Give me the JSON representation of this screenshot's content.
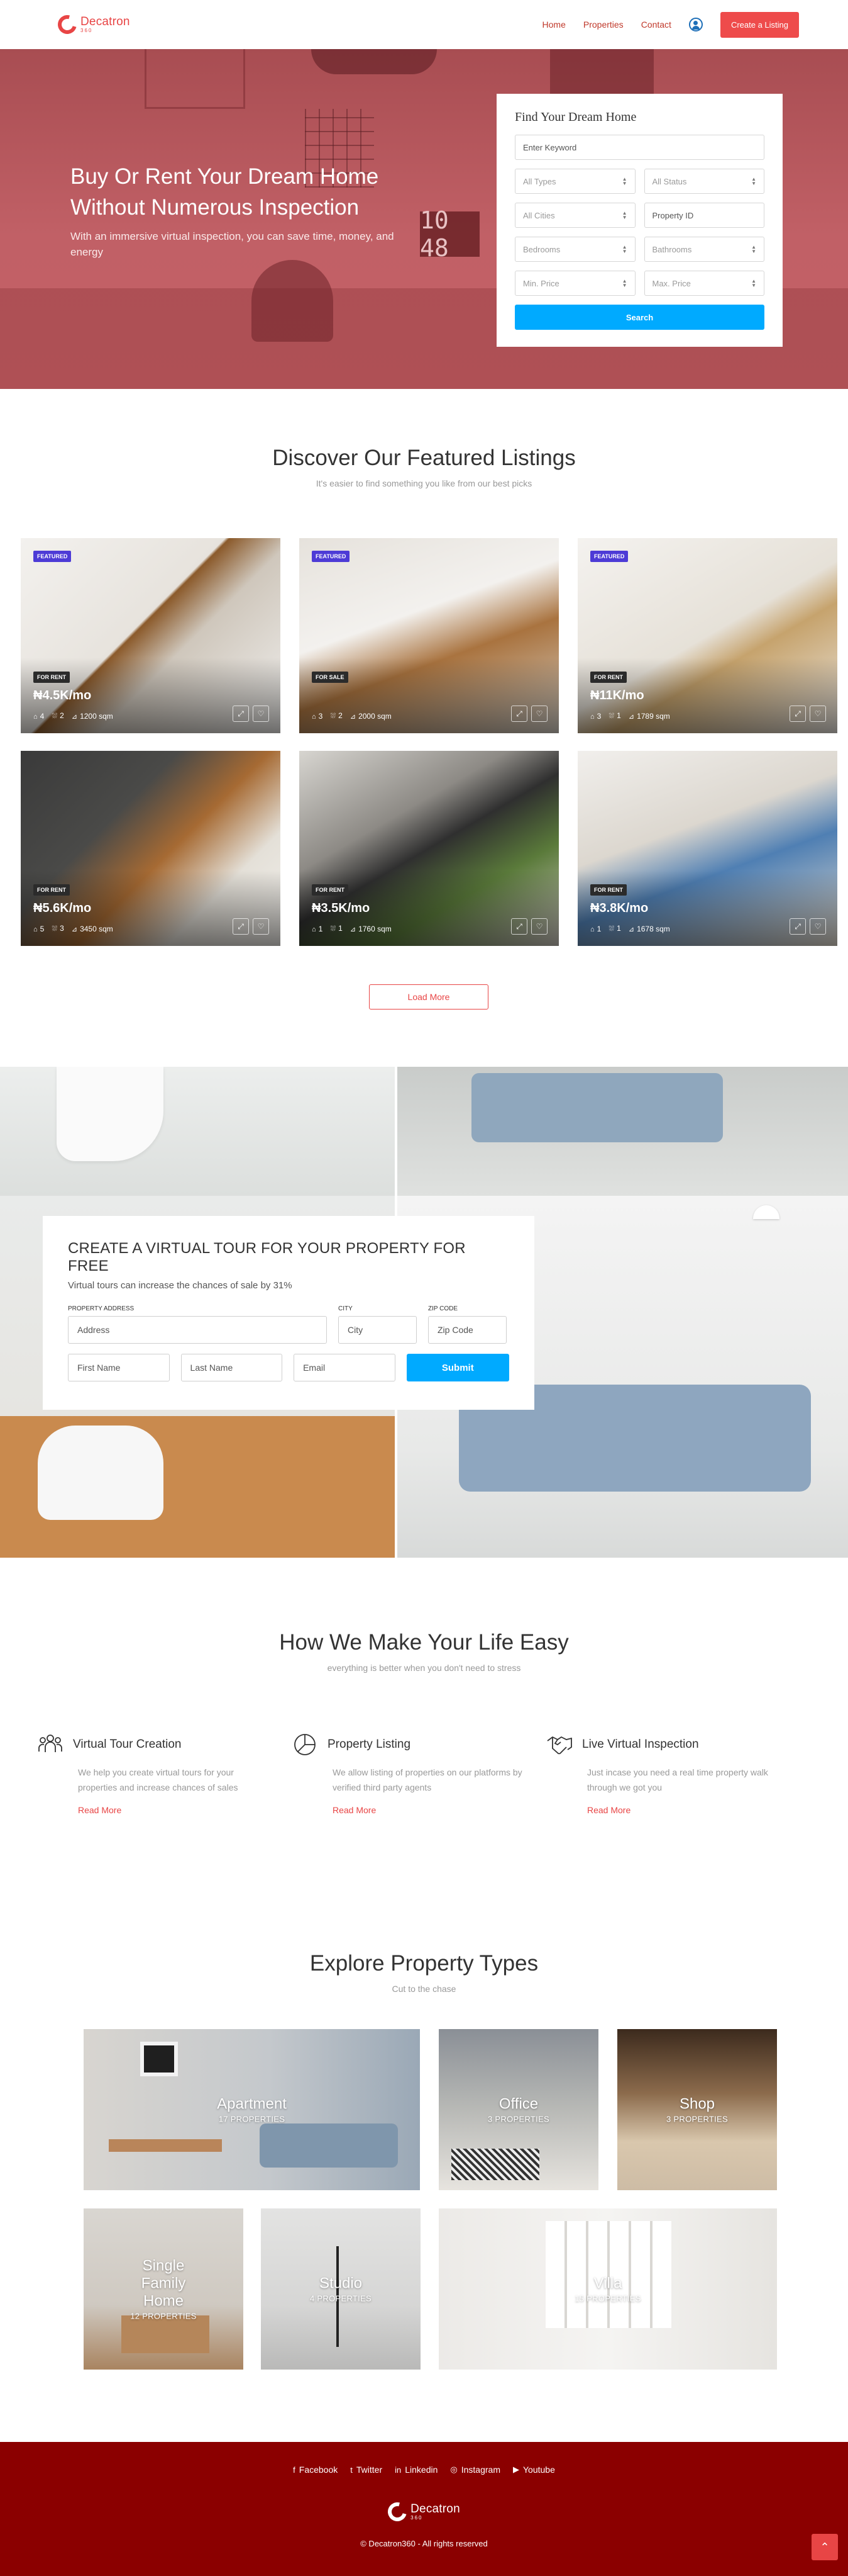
{
  "nav": {
    "logo_name": "Decatron",
    "logo_sub": "360",
    "links": [
      "Home",
      "Properties",
      "Contact"
    ],
    "create_label": "Create a Listing"
  },
  "hero": {
    "title_line1": "Buy Or Rent Your Dream Home",
    "title_line2": "Without Numerous Inspection",
    "description": "With an immersive virtual inspection, you can save time, money, and energy",
    "clock_text": "10 48"
  },
  "search": {
    "title": "Find Your Dream Home",
    "keyword_placeholder": "Enter Keyword",
    "types": "All Types",
    "status": "All Status",
    "cities": "All Cities",
    "property_id": "Property ID",
    "bedrooms": "Bedrooms",
    "bathrooms": "Bathrooms",
    "min_price": "Min. Price",
    "max_price": "Max. Price",
    "button": "Search"
  },
  "featured": {
    "title": "Discover Our Featured Listings",
    "subtitle": "It's easier to find something you like from our best picks",
    "load_more": "Load More",
    "cards": [
      {
        "featured": "FEATURED",
        "status": "FOR RENT",
        "price": "₦4.5K/mo",
        "beds": "4",
        "baths": "2",
        "area": "1200 sqm"
      },
      {
        "featured": "FEATURED",
        "status": "FOR SALE",
        "price": "",
        "beds": "3",
        "baths": "2",
        "area": "2000 sqm"
      },
      {
        "featured": "FEATURED",
        "status": "FOR RENT",
        "price": "₦11K/mo",
        "beds": "3",
        "baths": "1",
        "area": "1789 sqm"
      },
      {
        "featured": "",
        "status": "FOR RENT",
        "price": "₦5.6K/mo",
        "beds": "5",
        "baths": "3",
        "area": "3450 sqm"
      },
      {
        "featured": "",
        "status": "FOR RENT",
        "price": "₦3.5K/mo",
        "beds": "1",
        "baths": "1",
        "area": "1760 sqm"
      },
      {
        "featured": "",
        "status": "FOR RENT",
        "price": "₦3.8K/mo",
        "beds": "1",
        "baths": "1",
        "area": "1678 sqm"
      }
    ]
  },
  "vtour": {
    "title": "CREATE A VIRTUAL TOUR FOR YOUR PROPERTY FOR FREE",
    "subtitle": "Virtual tours can increase the chances of sale by 31%",
    "label_address": "PROPERTY ADDRESS",
    "label_city": "CITY",
    "label_zip": "ZIP CODE",
    "address_placeholder": "Address",
    "city_placeholder": "City",
    "zip_placeholder": "Zip Code",
    "first_placeholder": "First Name",
    "last_placeholder": "Last Name",
    "email_placeholder": "Email",
    "submit": "Submit"
  },
  "how": {
    "title": "How We Make Your Life Easy",
    "subtitle": "everything is better when you don't need to stress",
    "items": [
      {
        "name": "Virtual Tour Creation",
        "desc": "We help you create virtual tours for your properties and increase chances of sales",
        "more": "Read More",
        "icon": "people-icon"
      },
      {
        "name": "Property Listing",
        "desc": "We allow listing of properties on our platforms by verified third party agents",
        "more": "Read More",
        "icon": "chart-icon"
      },
      {
        "name": "Live Virtual Inspection",
        "desc": "Just incase you need a real time property walk through we got you",
        "more": "Read More",
        "icon": "handshake-icon"
      }
    ]
  },
  "types": {
    "title": "Explore Property Types",
    "subtitle": "Cut to the chase",
    "tiles": [
      {
        "name": "Apartment",
        "count": "17 PROPERTIES"
      },
      {
        "name": "Office",
        "count": "3 PROPERTIES"
      },
      {
        "name": "Shop",
        "count": "3 PROPERTIES"
      },
      {
        "name": "Single Family Home",
        "count": "12 PROPERTIES"
      },
      {
        "name": "Studio",
        "count": "4 PROPERTIES"
      },
      {
        "name": "Villa",
        "count": "15 PROPERTIES"
      }
    ]
  },
  "footer": {
    "socials": [
      "Facebook",
      "Twitter",
      "Linkedin",
      "Instagram",
      "Youtube"
    ],
    "logo_name": "Decatron",
    "logo_sub": "360",
    "copyright": "© Decatron360 - All rights reserved"
  },
  "colors": {
    "brand": "#e84545",
    "accent_blue": "#00aaff",
    "footer_bg": "#8b0000",
    "hero_overlay": "#b4565a",
    "featured_badge": "#4d3bd6"
  }
}
